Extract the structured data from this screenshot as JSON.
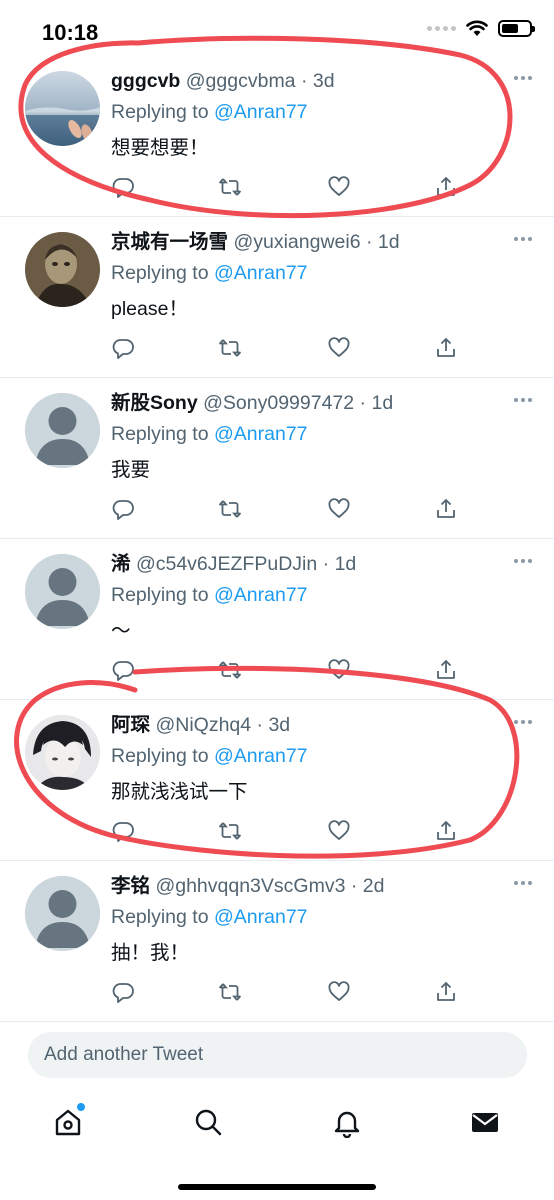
{
  "status_bar": {
    "time": "10:18"
  },
  "tweets": [
    {
      "name": "gggcvb",
      "handle": "@gggcvbma",
      "age": "3d",
      "replying_prefix": "Replying to",
      "mention": "@Anran77",
      "text": "想要想要！",
      "avatar": "sea-photo"
    },
    {
      "name": "京城有一场雪",
      "handle": "@yuxiangwei6",
      "age": "1d",
      "replying_prefix": "Replying to",
      "mention": "@Anran77",
      "text": "please！",
      "avatar": "portrait-painting"
    },
    {
      "name": "新股Sony",
      "handle": "@Sony09997472",
      "age": "1d",
      "replying_prefix": "Replying to",
      "mention": "@Anran77",
      "text": "我要",
      "avatar": "default-avatar"
    },
    {
      "name": "浠",
      "handle": "@c54v6JEZFPuDJin",
      "age": "1d",
      "replying_prefix": "Replying to",
      "mention": "@Anran77",
      "text": "～",
      "avatar": "default-avatar"
    },
    {
      "name": "阿琛",
      "handle": "@NiQzhq4",
      "age": "3d",
      "replying_prefix": "Replying to",
      "mention": "@Anran77",
      "text": "那就浅浅试一下",
      "avatar": "anime-avatar"
    },
    {
      "name": "李铭",
      "handle": "@ghhvqqn3VscGmv3",
      "age": "2d",
      "replying_prefix": "Replying to",
      "mention": "@Anran77",
      "text": "抽！我！",
      "avatar": "default-avatar"
    }
  ],
  "compose": {
    "placeholder": "Add another Tweet"
  },
  "tabbar": {
    "items": [
      "home-icon",
      "search-icon",
      "notifications-icon",
      "messages-icon"
    ]
  },
  "colors": {
    "accent": "#1d9bf0",
    "annotation": "#ee4b52",
    "secondary_text": "#536471"
  }
}
